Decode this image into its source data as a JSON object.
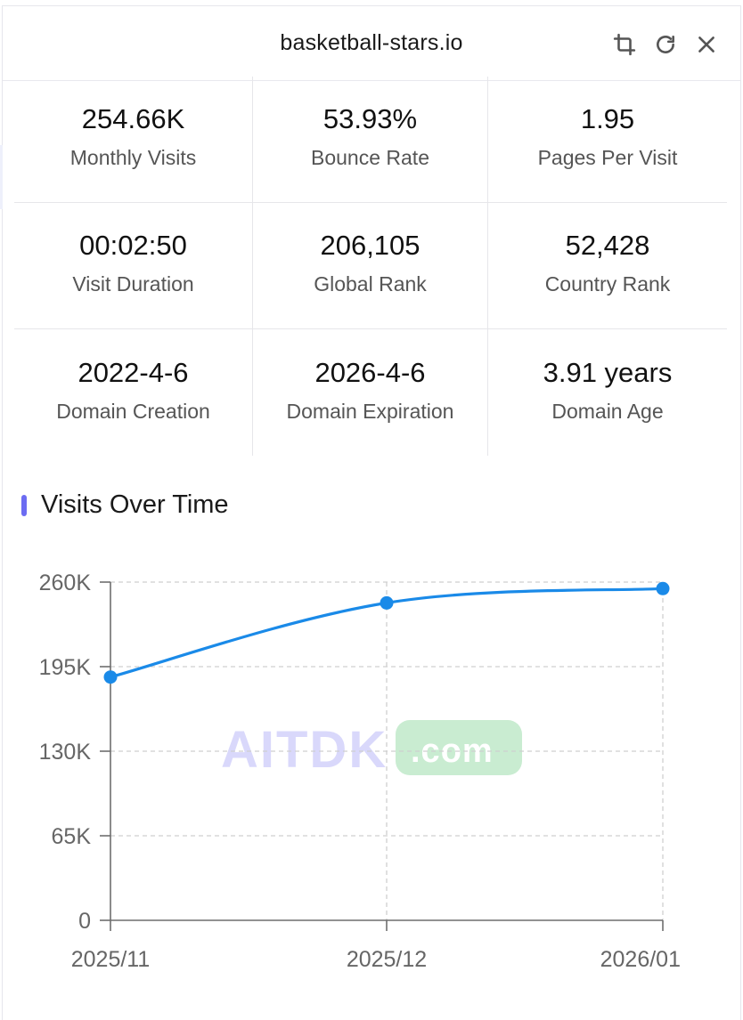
{
  "header": {
    "title": "basketball-stars.io",
    "actions": [
      {
        "icon": "crop-icon"
      },
      {
        "icon": "refresh-icon"
      },
      {
        "icon": "close-icon"
      }
    ]
  },
  "stats": [
    {
      "value": "254.66K",
      "label": "Monthly Visits"
    },
    {
      "value": "53.93%",
      "label": "Bounce Rate"
    },
    {
      "value": "1.95",
      "label": "Pages Per Visit"
    },
    {
      "value": "00:02:50",
      "label": "Visit Duration"
    },
    {
      "value": "206,105",
      "label": "Global Rank"
    },
    {
      "value": "52,428",
      "label": "Country Rank"
    },
    {
      "value": "2022-4-6",
      "label": "Domain Creation"
    },
    {
      "value": "2026-4-6",
      "label": "Domain Expiration"
    },
    {
      "value": "3.91 years",
      "label": "Domain Age"
    }
  ],
  "section": {
    "title": "Visits Over Time"
  },
  "watermark": {
    "brand": "AITDK",
    "suffix": ".com"
  },
  "colors": {
    "accent": "#6c6cf2",
    "line": "#1a8ae8",
    "watermark_text": "#d9d8fb",
    "watermark_badge": "#c9ecd1"
  },
  "chart_data": {
    "type": "line",
    "x": [
      "2025/11",
      "2025/12",
      "2026/01"
    ],
    "series": [
      {
        "values": [
          187000,
          244000,
          255000
        ]
      }
    ],
    "y_ticks": [
      "0",
      "65K",
      "130K",
      "195K",
      "260K"
    ],
    "ylim": [
      0,
      260000
    ],
    "grid": true,
    "smooth": true
  }
}
